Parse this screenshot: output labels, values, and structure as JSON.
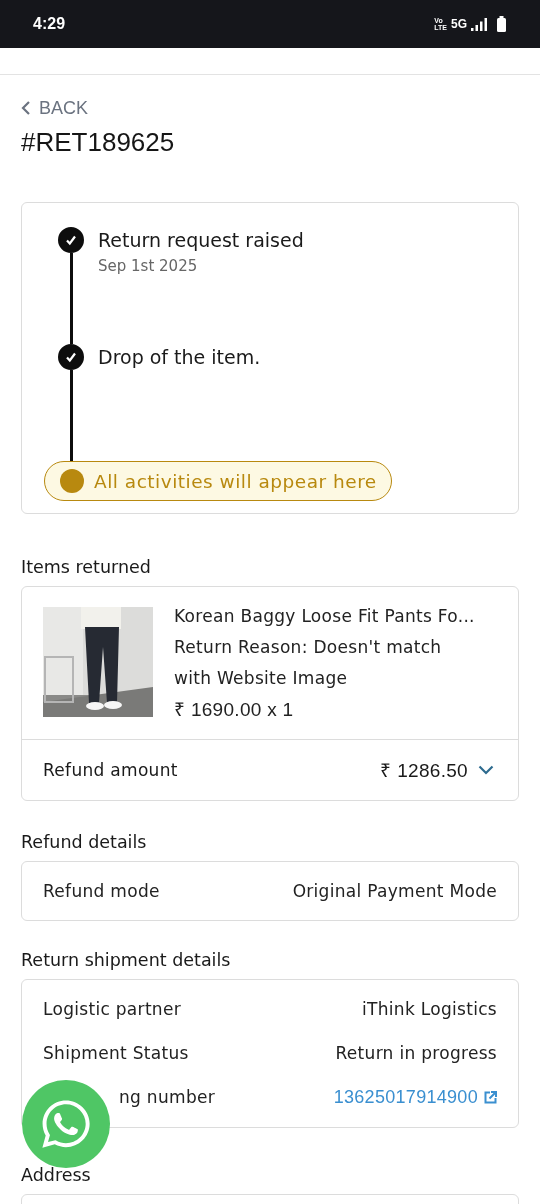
{
  "status_bar": {
    "time": "4:29",
    "volte_top": "Vo",
    "volte_bottom": "LTE",
    "network": "5G"
  },
  "back": {
    "label": "BACK"
  },
  "title": "#RET189625",
  "timeline": {
    "steps": [
      {
        "title": "Return request raised",
        "date": "Sep 1st 2025",
        "done": true
      },
      {
        "title": "Drop of the item.",
        "done": true
      }
    ],
    "notice": {
      "text": "All activities will appear here",
      "color": "#b8890f"
    }
  },
  "items_returned": {
    "heading": "Items returned",
    "items": [
      {
        "kind": "picture",
        "name": "Korean Baggy Loose Fit Pants Fo...",
        "reason": "Return Reason: Doesn't match with Website Image",
        "price": "₹ 1690.00 x 1"
      }
    ],
    "refund": {
      "label": "Refund amount",
      "value": "₹ 1286.50",
      "expanded": false
    }
  },
  "refund_details": {
    "heading": "Refund details",
    "rows": [
      {
        "label": "Refund mode",
        "value": "Original Payment Mode"
      }
    ]
  },
  "shipment": {
    "heading": "Return shipment details",
    "rows": [
      {
        "kind": "text",
        "label": "Logistic partner",
        "value": "iThink Logistics"
      },
      {
        "kind": "text",
        "label": "Shipment Status",
        "value": "Return in progress"
      },
      {
        "kind": "link",
        "label": "ng number",
        "value": "13625017914900"
      }
    ]
  },
  "address": {
    "heading": "Address"
  }
}
